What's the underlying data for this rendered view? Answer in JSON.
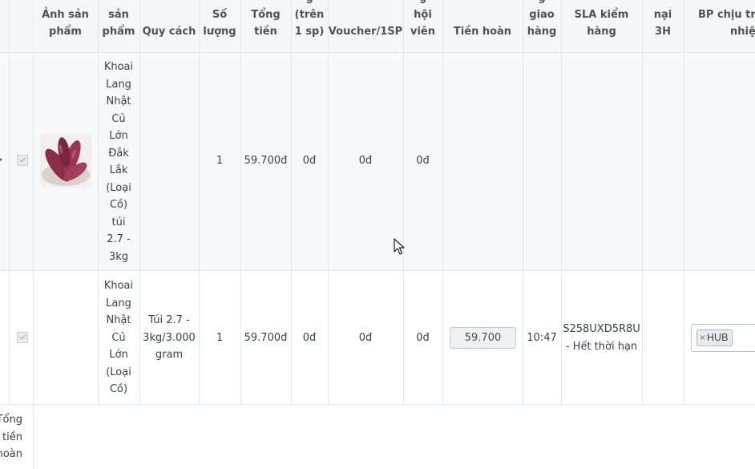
{
  "headers": {
    "image": [
      "Ảnh sản",
      "phẩm"
    ],
    "name": [
      "sản",
      "phẩm"
    ],
    "spec": [
      "Quy cách"
    ],
    "qty": [
      "Số",
      "lượng"
    ],
    "total": [
      "Tổng",
      "tiền"
    ],
    "discount": [
      "g",
      "(trên",
      "1 sp)"
    ],
    "voucher": [
      "Voucher/1SP"
    ],
    "member": [
      "g",
      "hội",
      "viên"
    ],
    "refund": [
      "Tiền hoàn"
    ],
    "delivery": [
      "g",
      "giao",
      "hàng"
    ],
    "sla": [
      "SLA kiểm",
      "hàng"
    ],
    "complaint": [
      "nại",
      "3H"
    ],
    "responsible": [
      "BP chịu trác",
      "nhiệm"
    ]
  },
  "rows": [
    {
      "checked": true,
      "image_icon": "sweet-potato-photo",
      "name_lines": [
        "Khoai",
        "Lang",
        "Nhật",
        "Củ",
        "Lớn",
        "Đắk",
        "Lắk",
        "(Loại",
        "Cồ)",
        "túi",
        "2.7 -",
        "3kg"
      ],
      "spec_lines": [],
      "qty": "1",
      "total": "59.700đ",
      "discount": "0đ",
      "voucher": "0đ",
      "member": "0đ"
    },
    {
      "checked": true,
      "name_lines": [
        "Khoai",
        "Lang",
        "Nhật",
        "Củ",
        "Lớn",
        "(Loại",
        "Cồ)"
      ],
      "spec_lines": [
        "Túi 2.7 -",
        "3kg/3.000",
        "gram"
      ],
      "qty": "1",
      "total": "59.700đ",
      "discount": "0đ",
      "voucher": "0đ",
      "member": "0đ",
      "refund_value": "59.700",
      "delivery_time": "10:47",
      "sla_lines": [
        "S258UXD5R8U",
        "- Hết thời hạn"
      ],
      "responsible_tag": "HUB",
      "tag_remove": "×"
    }
  ],
  "footer": {
    "total_refund_lines": [
      "Tổng",
      "tiền",
      "hoàn"
    ]
  },
  "colors": {
    "header_bg": "#f4f6f8",
    "row_alt_bg": "#f8f9fa",
    "border": "#e3e6ea"
  }
}
